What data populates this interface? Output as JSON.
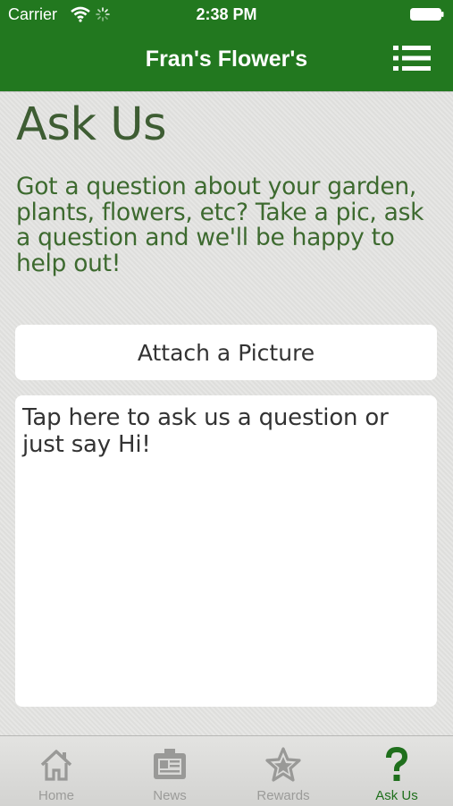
{
  "status_bar": {
    "carrier": "Carrier",
    "time": "2:38 PM"
  },
  "nav": {
    "title": "Fran's Flower's",
    "menu_icon": "list-menu-icon"
  },
  "main": {
    "title": "Ask Us",
    "intro": "Got a question about your garden, plants, flowers, etc? Take a pic, ask a question and we'll be happy to help out!",
    "attach_label": "Attach a Picture",
    "question_placeholder": "Tap here to ask us a question or just say Hi!"
  },
  "tabs": [
    {
      "label": "Home",
      "icon": "home-icon",
      "active": false
    },
    {
      "label": "News",
      "icon": "newspaper-icon",
      "active": false
    },
    {
      "label": "Rewards",
      "icon": "star-icon",
      "active": false
    },
    {
      "label": "Ask Us",
      "icon": "question-mark-icon",
      "active": true
    }
  ],
  "colors": {
    "header": "#22781f",
    "title_text": "#3e5d33",
    "intro_text": "#3d6a2f",
    "tab_active": "#1f6f1c",
    "tab_inactive": "#9b9b99"
  }
}
